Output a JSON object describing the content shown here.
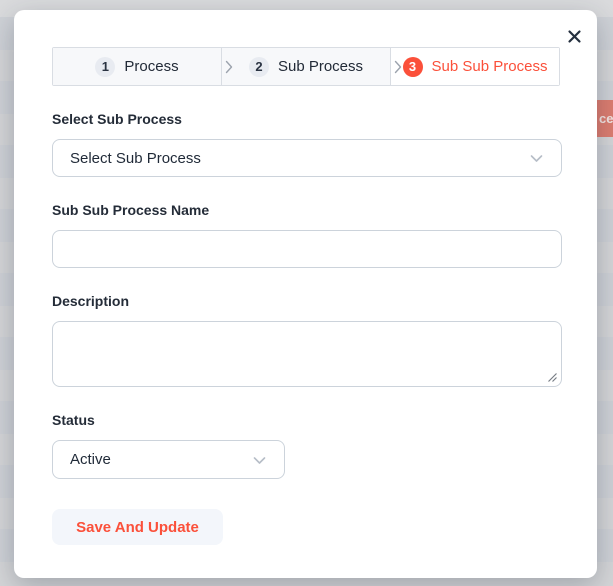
{
  "backdrop": {
    "partial_button_text": "ce"
  },
  "modal": {
    "steps": [
      {
        "number": "1",
        "label": "Process",
        "active": false
      },
      {
        "number": "2",
        "label": "Sub Process",
        "active": false
      },
      {
        "number": "3",
        "label": "Sub Sub Process",
        "active": true
      }
    ],
    "form": {
      "sub_process": {
        "label": "Select Sub Process",
        "value": "Select Sub Process"
      },
      "name": {
        "label": "Sub Sub Process Name",
        "value": ""
      },
      "description": {
        "label": "Description",
        "value": ""
      },
      "status": {
        "label": "Status",
        "value": "Active"
      }
    },
    "save_button_label": "Save And Update"
  },
  "icons": {
    "close": "close-icon",
    "select_caret": "chevron-down-icon",
    "step_separator": "chevron-right-icon",
    "textarea_corner": "resize-handle-icon"
  },
  "colors": {
    "accent": "#fb503a",
    "step_inactive_bg": "#f7f8fa",
    "stepper_border": "#d9dde3",
    "input_border": "#ccd3db",
    "save_button_bg": "#f3f6fb",
    "backdrop": "#d5d6d8",
    "dimmed_red_button": "#dd7d70"
  }
}
